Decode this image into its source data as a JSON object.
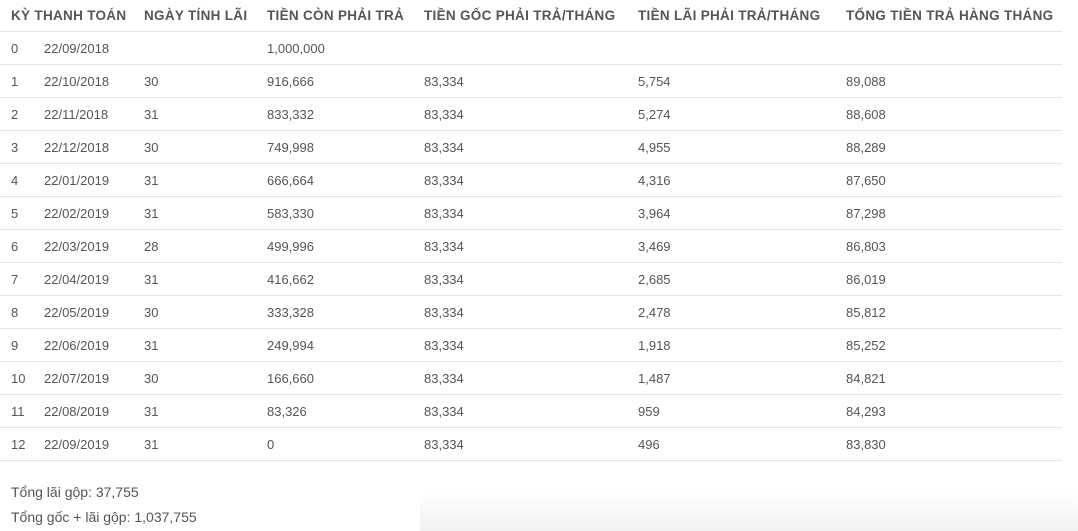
{
  "table": {
    "headers": [
      "KỲ THANH TOÁN",
      "NGÀY TÍNH LÃI",
      "TIỀN CÒN PHẢI TRẢ",
      "TIỀN GỐC PHẢI TRẢ/THÁNG",
      "TIỀN LÃI PHẢI TRẢ/THÁNG",
      "TỔNG TIỀN TRẢ HÀNG THÁNG"
    ],
    "rows": [
      [
        "0",
        "22/09/2018",
        "",
        "1,000,000",
        "",
        "",
        ""
      ],
      [
        "1",
        "22/10/2018",
        "30",
        "916,666",
        "83,334",
        "5,754",
        "89,088"
      ],
      [
        "2",
        "22/11/2018",
        "31",
        "833,332",
        "83,334",
        "5,274",
        "88,608"
      ],
      [
        "3",
        "22/12/2018",
        "30",
        "749,998",
        "83,334",
        "4,955",
        "88,289"
      ],
      [
        "4",
        "22/01/2019",
        "31",
        "666,664",
        "83,334",
        "4,316",
        "87,650"
      ],
      [
        "5",
        "22/02/2019",
        "31",
        "583,330",
        "83,334",
        "3,964",
        "87,298"
      ],
      [
        "6",
        "22/03/2019",
        "28",
        "499,996",
        "83,334",
        "3,469",
        "86,803"
      ],
      [
        "7",
        "22/04/2019",
        "31",
        "416,662",
        "83,334",
        "2,685",
        "86,019"
      ],
      [
        "8",
        "22/05/2019",
        "30",
        "333,328",
        "83,334",
        "2,478",
        "85,812"
      ],
      [
        "9",
        "22/06/2019",
        "31",
        "249,994",
        "83,334",
        "1,918",
        "85,252"
      ],
      [
        "10",
        "22/07/2019",
        "30",
        "166,660",
        "83,334",
        "1,487",
        "84,821"
      ],
      [
        "11",
        "22/08/2019",
        "31",
        "83,326",
        "83,334",
        "959",
        "84,293"
      ],
      [
        "12",
        "22/09/2019",
        "31",
        "0",
        "83,334",
        "496",
        "83,830"
      ]
    ]
  },
  "summary": {
    "total_interest": "Tổng lãi gộp: 37,755",
    "total_principal_interest": "Tổng gốc + lãi gộp: 1,037,755"
  }
}
